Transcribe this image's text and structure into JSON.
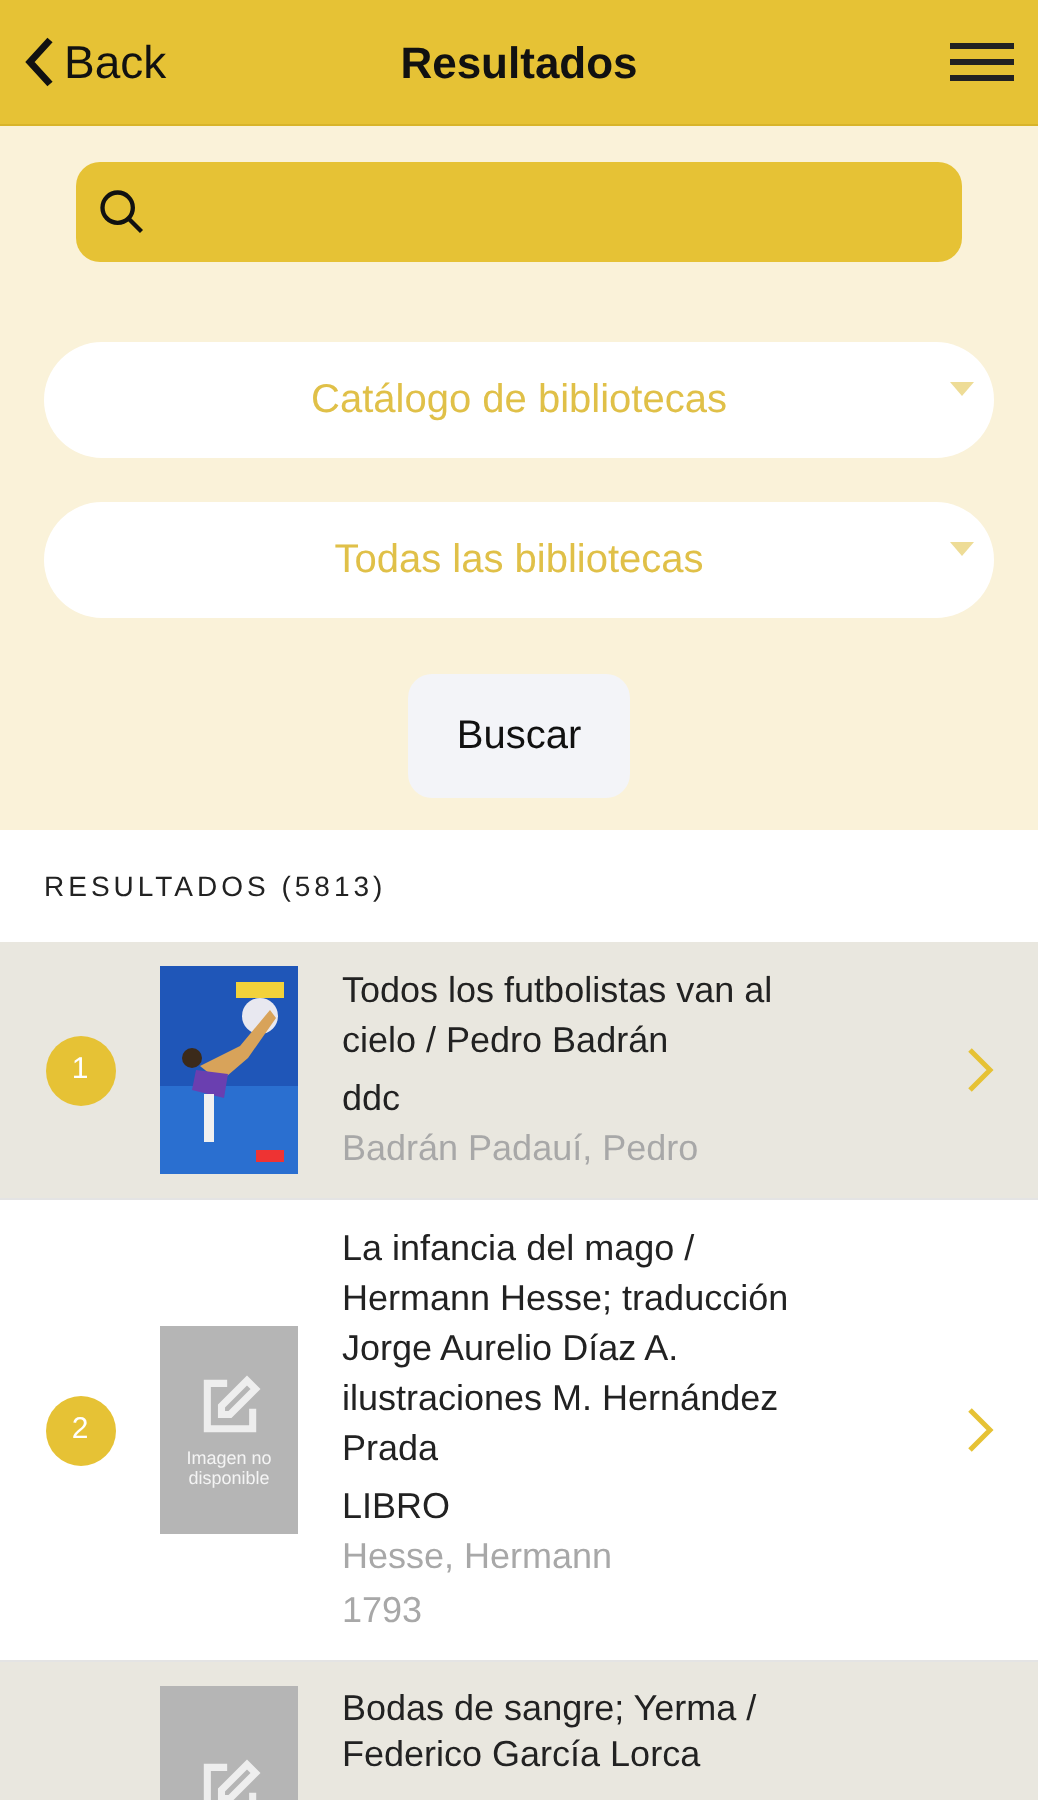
{
  "nav": {
    "back": "Back",
    "title": "Resultados"
  },
  "selects": [
    {
      "value": "Catálogo de bibliotecas"
    },
    {
      "value": "Todas las bibliotecas"
    }
  ],
  "button": "Buscar",
  "results_header": "RESULTADOS (5813)",
  "results": [
    {
      "number": "1",
      "title": "Todos los futbolistas van al cielo / Pedro Badrán",
      "type": "ddc",
      "author": "Badrán Padauí, Pedro"
    },
    {
      "number": "2",
      "cover": {
        "kind": "placeholder",
        "text": "Imagen no disponible"
      },
      "title": "La infancia del mago / Hermann Hesse; traducción Jorge Aurelio Díaz A. ilustraciones M. Hernández Prada",
      "type": "LIBRO",
      "author": "Hesse, Hermann",
      "year": "1793"
    },
    {
      "cover": {
        "kind": "placeholder"
      },
      "title": "Bodas de sangre; Yerma / Federico García Lorca"
    }
  ]
}
